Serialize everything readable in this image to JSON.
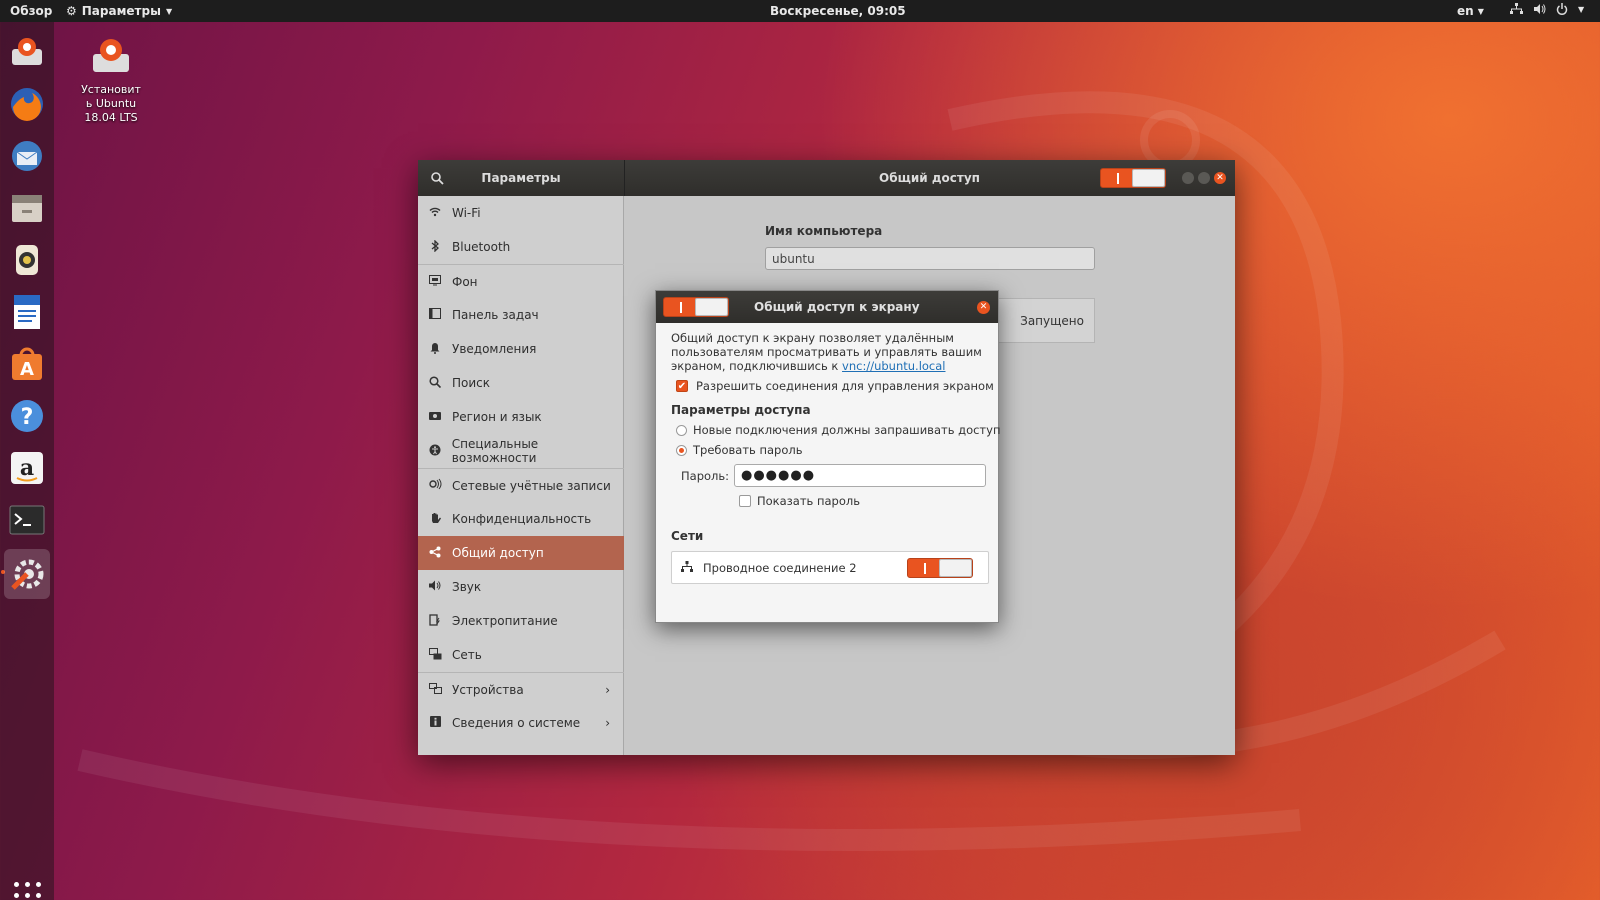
{
  "topbar": {
    "activities": "Обзор",
    "app_menu": "Параметры",
    "clock": "Воскресенье, 09:05",
    "lang": "en"
  },
  "desktop": {
    "installer_label": "Установит\nь Ubuntu\n18.04 LTS"
  },
  "dock": {
    "items": [
      "firefox-icon",
      "thunderbird-icon",
      "files-icon",
      "rhythmbox-icon",
      "writer-icon",
      "software-center-icon",
      "help-icon",
      "amazon-icon",
      "terminal-icon",
      "settings-icon"
    ],
    "accent": "#e95420"
  },
  "settings": {
    "left_title": "Параметры",
    "right_title": "Общий доступ",
    "sidebar": [
      {
        "label": "Wi-Fi",
        "icon": "wifi-icon"
      },
      {
        "label": "Bluetooth",
        "icon": "bluetooth-icon"
      },
      {
        "label": "Фон",
        "icon": "background-icon"
      },
      {
        "label": "Панель задач",
        "icon": "dock-icon"
      },
      {
        "label": "Уведомления",
        "icon": "bell-icon"
      },
      {
        "label": "Поиск",
        "icon": "search-icon"
      },
      {
        "label": "Регион и язык",
        "icon": "region-icon"
      },
      {
        "label": "Специальные возможности",
        "icon": "accessibility-icon"
      },
      {
        "label": "Сетевые учётные записи",
        "icon": "online-accounts-icon"
      },
      {
        "label": "Конфиденциальность",
        "icon": "privacy-hand-icon"
      },
      {
        "label": "Общий доступ",
        "icon": "share-icon"
      },
      {
        "label": "Звук",
        "icon": "speaker-icon"
      },
      {
        "label": "Электропитание",
        "icon": "power-icon"
      },
      {
        "label": "Сеть",
        "icon": "network-icon"
      },
      {
        "label": "Устройства",
        "icon": "devices-icon"
      },
      {
        "label": "Сведения о системе",
        "icon": "info-icon"
      }
    ],
    "selected": "Общий доступ",
    "computer_name_label": "Имя компьютера",
    "computer_name_value": "ubuntu",
    "screen_sharing_status": "Запущено"
  },
  "dialog": {
    "title": "Общий доступ к экрану",
    "desc_text": "Общий доступ к экрану позволяет удалённым пользователям просматривать и управлять вашим экраном, подключившись к ",
    "desc_link": "vnc://ubuntu.local",
    "allow_control": "Разрешить соединения для управления экраном",
    "allow_control_checked": true,
    "access_header": "Параметры доступа",
    "option_ask": "Новые подключения должны запрашивать доступ",
    "option_password": "Требовать пароль",
    "selected_option": "password",
    "password_label": "Пароль:",
    "password_value": "●●●●●●",
    "show_password": "Показать пароль",
    "show_password_checked": false,
    "networks_header": "Сети",
    "network_name": "Проводное соединение 2",
    "network_enabled": true
  }
}
